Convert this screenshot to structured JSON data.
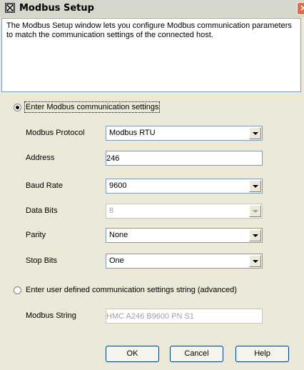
{
  "window": {
    "title": "Modbus Setup",
    "close_glyph": "×"
  },
  "description": "The Modbus Setup window lets you configure Modbus communication parameters to match the communication settings of the connected host.",
  "mode_standard": {
    "label": "Enter Modbus communication settings",
    "selected": true
  },
  "fields": {
    "protocol": {
      "label": "Modbus Protocol",
      "value": "Modbus RTU"
    },
    "address": {
      "label": "Address",
      "value": "246"
    },
    "baud_rate": {
      "label": "Baud Rate",
      "value": "9600"
    },
    "data_bits": {
      "label": "Data Bits",
      "value": "8",
      "disabled": true
    },
    "parity": {
      "label": "Parity",
      "value": "None"
    },
    "stop_bits": {
      "label": "Stop Bits",
      "value": "One"
    }
  },
  "mode_advanced": {
    "label": "Enter user defined communication settings string (advanced)",
    "selected": false
  },
  "modbus_string": {
    "label": "Modbus String",
    "value": "HMC A246 B9600 PN S1",
    "disabled": true
  },
  "buttons": {
    "ok": "OK",
    "cancel": "Cancel",
    "help": "Help"
  },
  "colors": {
    "dialog_bg": "#ece9d8",
    "titlebar_bg": "#d7d6cc",
    "field_border": "#7f9db9",
    "disabled_text": "#a0a0a0"
  }
}
